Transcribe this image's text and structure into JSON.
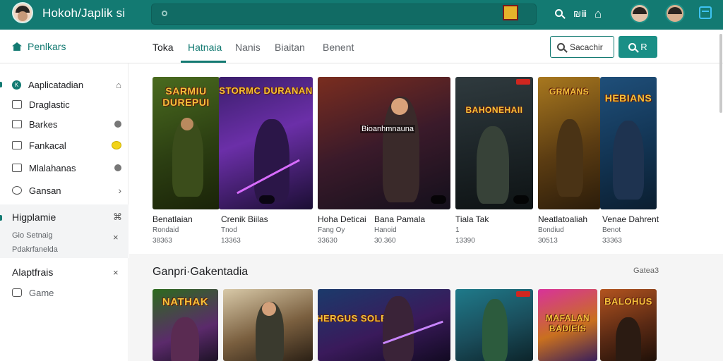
{
  "header": {
    "app_title": "Hokoh/Japlik si",
    "icons": [
      "search-icon",
      "grid-icon",
      "bell-icon",
      "calendar-icon"
    ],
    "search_icon_label": "Q",
    "grid_label": "₪ⅲ",
    "bell_label": "⌂"
  },
  "nav": {
    "home_label": "Penlkars",
    "tabs": [
      "Toka",
      "Hatnaia",
      "Nanis",
      "Biaitan",
      "Benent"
    ],
    "active_tab": 1,
    "search_button_label": "Sacachir",
    "search_button2_label": "R"
  },
  "sidebar": {
    "items": [
      {
        "label": "Aaplicatadian",
        "icon": "k-logo-icon",
        "right": "⌂"
      },
      {
        "label": "Draglastic",
        "icon": "window-icon",
        "right": ""
      },
      {
        "label": "Barkes",
        "icon": "window-icon",
        "right": "dot"
      },
      {
        "label": "Fankacal",
        "icon": "window-icon",
        "right": "yellow"
      },
      {
        "label": "Mlalahanas",
        "icon": "window-icon",
        "right": "dot"
      },
      {
        "label": "Gansan",
        "icon": "circle-icon",
        "right": "›"
      }
    ],
    "section1": {
      "title": "Higplamie",
      "right": "⌘",
      "sub1": "Gio Setnaig",
      "sub2": "Pdakrfanelda",
      "x": "×"
    },
    "section2": {
      "title": "Alaptfrais",
      "x": "×",
      "item": "Game"
    }
  },
  "featured": [
    {
      "name": "Benatlaian",
      "meta1": "Rondaid",
      "meta2": "38363",
      "art": "SARMIU DUREPUI"
    },
    {
      "name": "Crenik Biilas",
      "meta1": "Tnod",
      "meta2": "13363",
      "art": "STORMC DURANAN"
    },
    {
      "name": "Hoha Deticai",
      "meta1": "Fang Oy",
      "meta2": "33630",
      "art": "",
      "overlay": "Bioanhmnauna"
    },
    {
      "name": "Bana Pamala",
      "meta1": "Hanoid",
      "meta2": "30.360",
      "art": ""
    },
    {
      "name": "Tiala Tak",
      "meta1": "1",
      "meta2": "13390",
      "art": "BAHONEHAII"
    },
    {
      "name": "Neatlatoaliah",
      "meta1": "Bondiud",
      "meta2": "30513",
      "art": "GRMANS"
    },
    {
      "name": "Venae Dahrent",
      "meta1": "Benot",
      "meta2": "33363",
      "art": "HEBIANS"
    }
  ],
  "section": {
    "title": "Ganpri·Gakentadia",
    "more": "Gatea3"
  },
  "lower": [
    {
      "art": "NATHAK"
    },
    {
      "art": ""
    },
    {
      "art": "HERGUS SOLETIED"
    },
    {
      "art": ""
    },
    {
      "art": "MAFALAN BADIEIS"
    },
    {
      "art": "BALOHUS"
    }
  ],
  "colors": {
    "accent": "#137a72",
    "topbar": "#137a72",
    "button": "#1a8f86"
  }
}
